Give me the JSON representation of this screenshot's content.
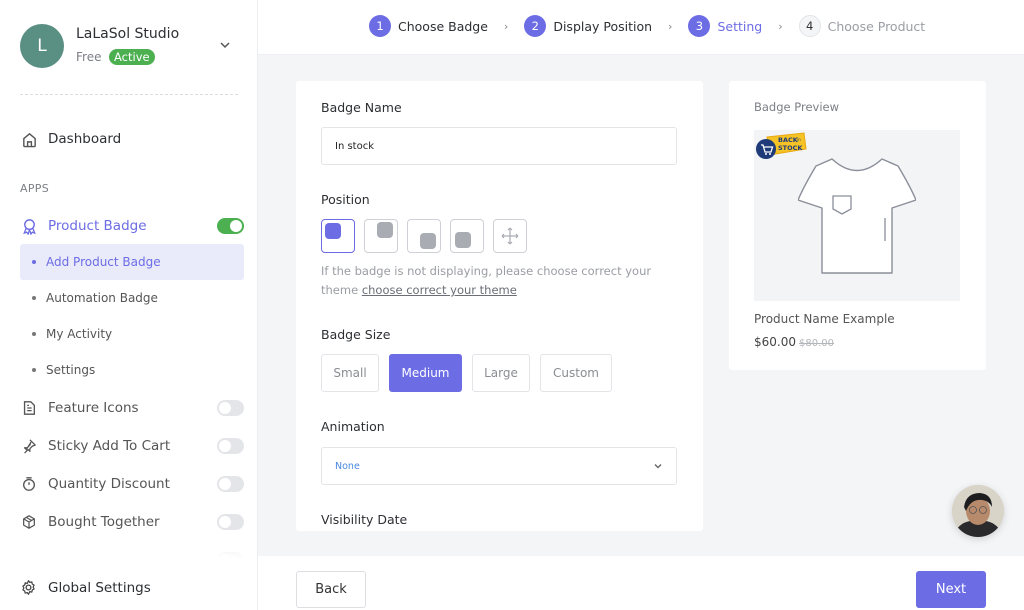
{
  "store": {
    "avatar_letter": "L",
    "name": "LaLaSol Studio",
    "plan": "Free",
    "status": "Active"
  },
  "sidebar": {
    "dashboard": "Dashboard",
    "section_label": "APPS",
    "apps": [
      {
        "label": "Product Badge",
        "icon": "badge-ribbon-icon",
        "enabled": true
      },
      {
        "label": "Feature Icons",
        "icon": "document-icon",
        "enabled": false
      },
      {
        "label": "Sticky Add To Cart",
        "icon": "pin-icon",
        "enabled": false
      },
      {
        "label": "Quantity Discount",
        "icon": "stopwatch-icon",
        "enabled": false
      },
      {
        "label": "Bought Together",
        "icon": "package-icon",
        "enabled": false
      }
    ],
    "sub_items": [
      {
        "label": "Add Product Badge",
        "active": true
      },
      {
        "label": "Automation Badge",
        "active": false
      },
      {
        "label": "My Activity",
        "active": false
      },
      {
        "label": "Settings",
        "active": false
      }
    ],
    "global_settings": "Global Settings"
  },
  "steps": [
    {
      "num": "1",
      "label": "Choose Badge",
      "state": "done"
    },
    {
      "num": "2",
      "label": "Display Position",
      "state": "done"
    },
    {
      "num": "3",
      "label": "Setting",
      "state": "current"
    },
    {
      "num": "4",
      "label": "Choose Product",
      "state": "future"
    }
  ],
  "form": {
    "badge_name_label": "Badge Name",
    "badge_name_value": "In stock",
    "position_label": "Position",
    "position_options": [
      "top-left",
      "top-right",
      "bottom-right",
      "bottom-left",
      "free-move"
    ],
    "position_selected": "top-left",
    "hint_text": "If the badge is not displaying, please choose correct your theme ",
    "hint_link": "choose correct your theme",
    "size_label": "Badge Size",
    "sizes": [
      "Small",
      "Medium",
      "Large",
      "Custom"
    ],
    "size_selected": "Medium",
    "animation_label": "Animation",
    "animation_value": "None",
    "visibility_label": "Visibility Date"
  },
  "preview": {
    "title": "Badge Preview",
    "badge_text_1": "BACK",
    "badge_text_2": "in",
    "badge_text_3": "STOCK",
    "product_name": "Product Name Example",
    "price": "$60.00",
    "old_price": "$80.00"
  },
  "footer": {
    "back": "Back",
    "next": "Next"
  },
  "colors": {
    "accent": "#6c6ce5",
    "toggle_on": "#4caf50",
    "status_active": "#4caf50"
  }
}
